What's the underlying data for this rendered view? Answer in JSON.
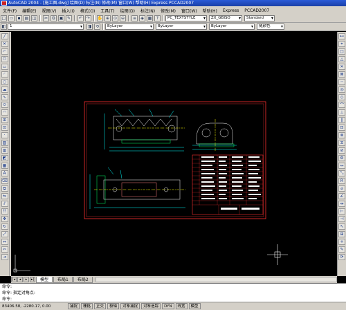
{
  "window": {
    "title": "AutoCAD 2004 - [施工图.dwg]  绘图(D) 标注(N) 修改(M) 窗口(W) 帮助(H)  Express  PCCAD2007"
  },
  "menu": [
    "文件(F)",
    "编辑(E)",
    "视图(V)",
    "插入(I)",
    "格式(O)",
    "工具(T)",
    "绘图(D)",
    "标注(N)",
    "修改(M)",
    "窗口(W)",
    "帮助(H)",
    "Express",
    "PCCAD2007"
  ],
  "toolbar": {
    "textstyle": "PC_TEXTSTYLE",
    "dimstyle": "ZX_GBISO",
    "tablestyle": "Standard",
    "layer": "1",
    "color": "ByLayer",
    "linetype": "ByLayer",
    "lineweight": "ByLayer",
    "plotstyle": "随颜色"
  },
  "tabs": [
    "模型",
    "布局1",
    "布局2"
  ],
  "command": {
    "line1": "命令:",
    "line2": "命令: 指定对角点:",
    "line3": "命令:"
  },
  "status": {
    "coords": "83406.58, -2280.17, 0.00",
    "buttons": [
      "捕捉",
      "栅格",
      "正交",
      "极轴",
      "对象捕捉",
      "对象追踪",
      "DYN",
      "线宽",
      "模型"
    ]
  },
  "drawing": {
    "title_block": {
      "cells": [
        "技术要求",
        "",
        "",
        "",
        "",
        ""
      ]
    },
    "colors": {
      "frame": "#ff3030",
      "part": "#ffffff",
      "dim": "#00ffff",
      "center": "#ffff00",
      "green": "#00ff66"
    }
  }
}
